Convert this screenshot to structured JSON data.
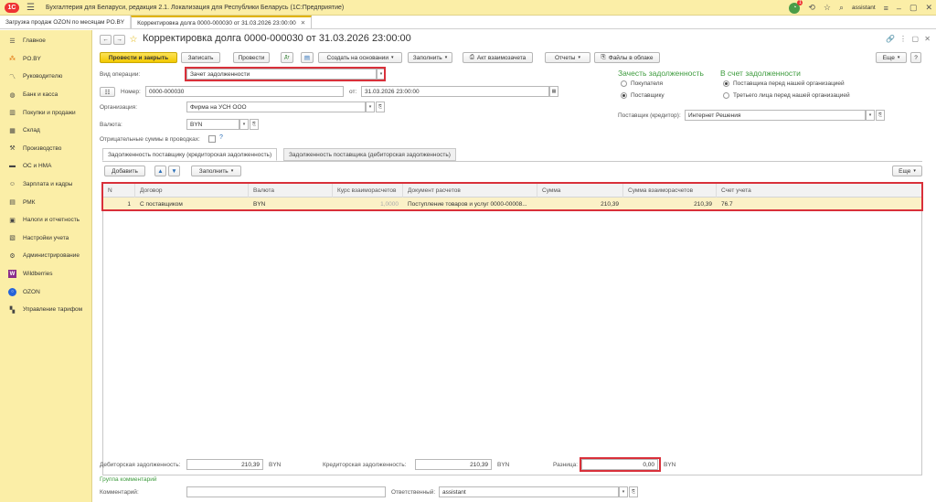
{
  "app": {
    "logo": "1С",
    "title": "Бухгалтерия для Беларуси, редакция 2.1. Локализация для Республики Беларусь   (1С:Предприятие)",
    "user": "assistant",
    "notifications": "1"
  },
  "window_tabs": [
    {
      "label": "Загрузка продаж OZON по месяцам PO.BY"
    },
    {
      "label": "Корректировка долга 0000-000030 от 31.03.2026 23:00:00"
    }
  ],
  "sidebar": {
    "items": [
      {
        "label": "Главное",
        "icon": "menu-icon"
      },
      {
        "label": "PO.BY",
        "icon": "poby-icon"
      },
      {
        "label": "Руководителю",
        "icon": "chart-icon"
      },
      {
        "label": "Банк и касса",
        "icon": "bank-icon"
      },
      {
        "label": "Покупки и продажи",
        "icon": "cart-icon"
      },
      {
        "label": "Склад",
        "icon": "warehouse-icon"
      },
      {
        "label": "Производство",
        "icon": "factory-icon"
      },
      {
        "label": "ОС и НМА",
        "icon": "assets-icon"
      },
      {
        "label": "Зарплата и кадры",
        "icon": "people-icon"
      },
      {
        "label": "РМК",
        "icon": "cashier-icon"
      },
      {
        "label": "Налоги и отчетность",
        "icon": "taxes-icon"
      },
      {
        "label": "Настройки учета",
        "icon": "settings-icon"
      },
      {
        "label": "Администрирование",
        "icon": "gear-icon"
      },
      {
        "label": "Wildberries",
        "icon": "wildberries-icon"
      },
      {
        "label": "OZON",
        "icon": "ozon-icon"
      },
      {
        "label": "Управление тарифом",
        "icon": "tariff-icon"
      }
    ]
  },
  "doc": {
    "title": "Корректировка долга 0000-000030 от 31.03.2026 23:00:00",
    "toolbar": {
      "post_close": "Провести и закрыть",
      "save": "Записать",
      "post": "Провести",
      "create_based": "Создать на основании",
      "fill": "Заполнить",
      "act": "Акт взаимозачета",
      "reports": "Отчеты",
      "files": "Файлы в облаке",
      "more": "Еще"
    },
    "operation_label": "Вид операции:",
    "operation_value": "Зачет задолженности",
    "number_label": "Номер:",
    "number_value": "0000-000030",
    "date_label": "от:",
    "date_value": "31.03.2026 23:00:00",
    "org_label": "Организация:",
    "org_value": "Фирма на УСН ООО",
    "currency_label": "Валюта:",
    "currency_value": "BYN",
    "negative_label": "Отрицательные суммы в проводках:",
    "help": "?",
    "offset_title": "Зачесть задолженность",
    "offset_options": [
      "Покупателя",
      "Поставщику"
    ],
    "account_title": "В счет задолженности",
    "account_options": [
      "Поставщика перед нашей организацией",
      "Третьего лица перед нашей организацией"
    ],
    "supplier_label": "Поставщик (кредитор):",
    "supplier_value": "Интернет Решения",
    "tabs": [
      "Задолженность поставщику (кредиторская задолженность)",
      "Задолженность поставщика (дебиторская задолженность)"
    ],
    "table_toolbar": {
      "add": "Добавить",
      "fill": "Заполнить",
      "more": "Еще"
    },
    "columns": [
      "N",
      "Договор",
      "Валюта",
      "Курс взаиморасчетов",
      "Документ расчетов",
      "Сумма",
      "Сумма взаиморасчетов",
      "Счет учета"
    ],
    "rows": [
      [
        "1",
        "С поставщиком",
        "BYN",
        "1,0000",
        "Поступление товаров и услуг 0000-00008...",
        "210,39",
        "210,39",
        "76.7"
      ]
    ],
    "footer": {
      "debit_label": "Дебиторская задолженность:",
      "debit_value": "210,39",
      "debit_currency": "BYN",
      "credit_label": "Кредиторская задолженность:",
      "credit_value": "210,39",
      "credit_currency": "BYN",
      "diff_label": "Разница:",
      "diff_value": "0,00",
      "diff_currency": "BYN",
      "comments_group": "Группа комментарий",
      "comment_label": "Комментарий:",
      "comment_value": "",
      "responsible_label": "Ответственный:",
      "responsible_value": "assistant"
    }
  },
  "colors": {
    "accent": "#fbeea7",
    "primary_button": "#f2c800",
    "section_green": "#3d9b3d",
    "highlight_red": "#d9303a",
    "selected_row": "#fbf1c7"
  }
}
